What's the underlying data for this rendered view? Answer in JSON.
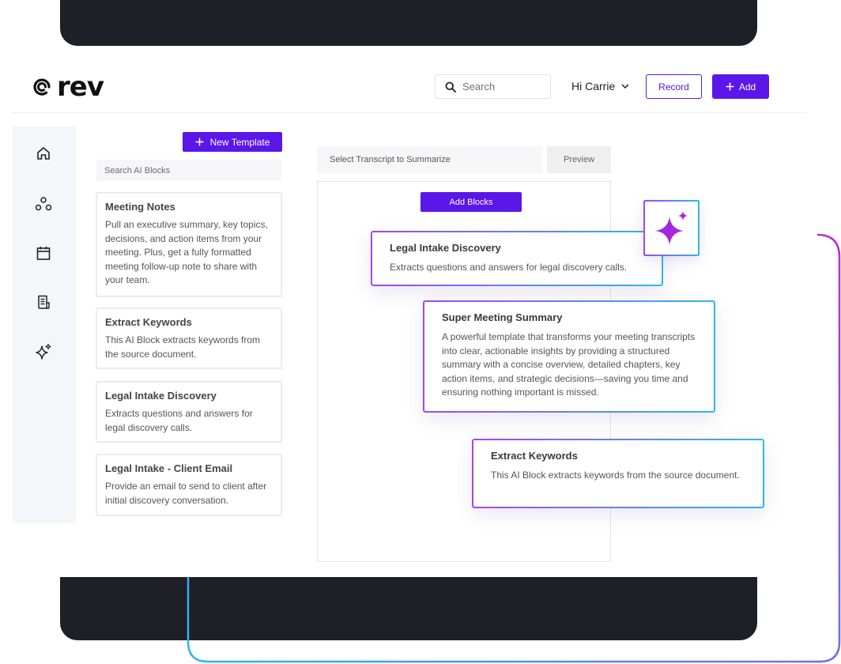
{
  "brand": {
    "logo_text": "rev"
  },
  "header": {
    "search_placeholder": "Search",
    "greeting": "Hi Carrie",
    "record_label": "Record",
    "add_label": "Add"
  },
  "sidebar": {
    "items": [
      {
        "icon": "home-icon"
      },
      {
        "icon": "people-icon"
      },
      {
        "icon": "calendar-icon"
      },
      {
        "icon": "document-icon"
      },
      {
        "icon": "sparkle-icon"
      }
    ]
  },
  "templates_panel": {
    "new_template_label": "New Template",
    "search_placeholder": "Search AI Blocks",
    "blocks": [
      {
        "title": "Meeting Notes",
        "description": "Pull an executive summary, key topics, decisions, and action items from your meeting. Plus, get a fully formatted meeting follow-up note to share with your team."
      },
      {
        "title": "Extract Keywords",
        "description": "This AI Block extracts keywords from the source document."
      },
      {
        "title": "Legal Intake Discovery",
        "description": "Extracts questions and answers for legal discovery calls."
      },
      {
        "title": "Legal Intake - Client Email",
        "description": "Provide an email to send to client after initial discovery conversation."
      }
    ]
  },
  "builder": {
    "select_transcript_label": "Select Transcript to Summarize",
    "preview_label": "Preview",
    "add_blocks_label": "Add Blocks",
    "added_blocks": [
      {
        "title": "Legal Intake Discovery",
        "description": "Extracts questions and answers for legal discovery calls."
      },
      {
        "title": "Super Meeting Summary",
        "description": "A powerful template that transforms your meeting transcripts into clear, actionable insights by providing a structured summary with a concise overview, detailed chapters, key action items, and strategic decisions—saving you time and ensuring nothing important is missed."
      },
      {
        "title": "Extract Keywords",
        "description": "This AI Block extracts keywords from the source document."
      }
    ]
  },
  "colors": {
    "accent": "#5b16e8",
    "gradient_start": "#a147f0",
    "gradient_end": "#2fb7ec",
    "dark_band": "#1e1f27"
  }
}
